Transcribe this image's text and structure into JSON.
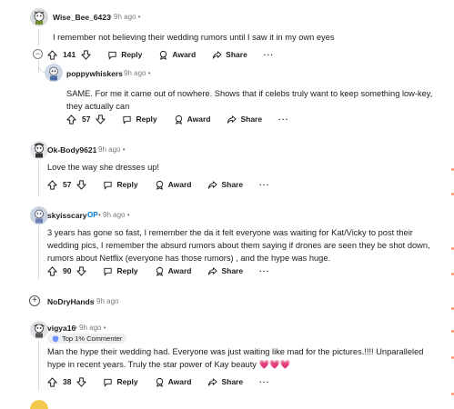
{
  "comments": [
    {
      "user": "Wise_Bee_6423",
      "time": "9h ago",
      "text": "I remember not believing their wedding rumors until I saw it in my own eyes",
      "votes": "141",
      "reply": "Reply",
      "award": "Award",
      "share": "Share",
      "more": "···"
    },
    {
      "user": "poppywhiskers",
      "time": "9h ago",
      "text": "SAME. For me it came out of nowhere. Shows that if celebs truly want to keep something low-key, they actually can",
      "votes": "57",
      "reply": "Reply",
      "award": "Award",
      "share": "Share",
      "more": "···"
    },
    {
      "user": "Ok-Body9621",
      "time": "9h ago",
      "text": "Love the way she dresses up!",
      "votes": "57",
      "reply": "Reply",
      "award": "Award",
      "share": "Share",
      "more": "···"
    },
    {
      "user": "skyisscary",
      "op": "OP",
      "time": "9h ago",
      "text": "3 years has gone so fast, I remember the da it felt everyone was waiting for Kat/Vicky to post their wedding pics, I remember the absurd rumors about them saying if drones are seen they be shot down, rumors about Netflix (everyone has those rumors) , and the hype was huge.",
      "votes": "90",
      "reply": "Reply",
      "award": "Award",
      "share": "Share",
      "more": "···"
    },
    {
      "user": "NoDryHands",
      "time": "9h ago",
      "collapsed": true
    },
    {
      "user": "vigya16",
      "time": "9h ago",
      "badge": "Top 1% Commenter",
      "text": "Man the hype their wedding had. Everyone was just waiting like mad for the pictures.!!!! Unparalleled hype in recent years. Truly the star power of Kay beauty 💗💗💗",
      "votes": "38",
      "reply": "Reply",
      "award": "Award",
      "share": "Share",
      "more": "···"
    }
  ],
  "colors": {
    "op": "#0079d3",
    "meta": "#7c7c7c",
    "line": "#dadada"
  }
}
